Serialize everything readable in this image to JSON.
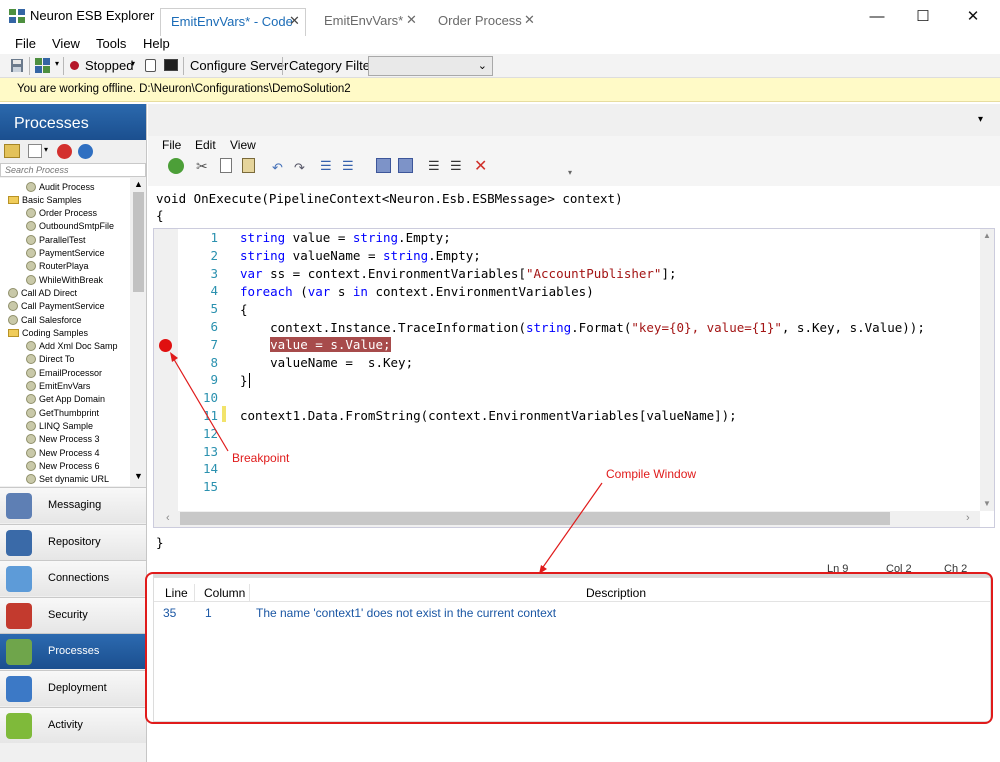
{
  "window": {
    "title": "Neuron ESB Explorer",
    "min_label": "—",
    "max_label": "☐",
    "close_label": "✕"
  },
  "menu": [
    "File",
    "View",
    "Tools",
    "Help"
  ],
  "toolbar": {
    "status": "Stopped",
    "configure_server": "Configure Server",
    "category_filter": "Category Filter",
    "category_value": ""
  },
  "offline_banner": "You are working offline. D:\\Neuron\\Configurations\\DemoSolution2",
  "left": {
    "header": "Processes",
    "search_placeholder": "Search Process",
    "tree": [
      {
        "label": "Audit Process",
        "level": 1,
        "type": "item"
      },
      {
        "label": "Basic Samples",
        "level": 0,
        "type": "folder"
      },
      {
        "label": "Order Process",
        "level": 1,
        "type": "item"
      },
      {
        "label": "OutboundSmtpFile",
        "level": 1,
        "type": "item"
      },
      {
        "label": "ParallelTest",
        "level": 1,
        "type": "item"
      },
      {
        "label": "PaymentService",
        "level": 1,
        "type": "item"
      },
      {
        "label": "RouterPlaya",
        "level": 1,
        "type": "item"
      },
      {
        "label": "WhileWithBreak",
        "level": 1,
        "type": "item"
      },
      {
        "label": "Call AD Direct",
        "level": 0,
        "type": "item"
      },
      {
        "label": "Call PaymentService",
        "level": 0,
        "type": "item"
      },
      {
        "label": "Call Salesforce",
        "level": 0,
        "type": "item"
      },
      {
        "label": "Coding Samples",
        "level": 0,
        "type": "folder"
      },
      {
        "label": "Add Xml Doc Samp",
        "level": 1,
        "type": "item"
      },
      {
        "label": "Direct To",
        "level": 1,
        "type": "item"
      },
      {
        "label": "EmailProcessor",
        "level": 1,
        "type": "item"
      },
      {
        "label": "EmitEnvVars",
        "level": 1,
        "type": "item"
      },
      {
        "label": "Get App Domain",
        "level": 1,
        "type": "item"
      },
      {
        "label": "GetThumbprint",
        "level": 1,
        "type": "item"
      },
      {
        "label": "LINQ Sample",
        "level": 1,
        "type": "item"
      },
      {
        "label": "New Process 3",
        "level": 1,
        "type": "item"
      },
      {
        "label": "New Process 4",
        "level": 1,
        "type": "item"
      },
      {
        "label": "New Process 6",
        "level": 1,
        "type": "item"
      },
      {
        "label": "Set dynamic URL",
        "level": 1,
        "type": "item"
      }
    ],
    "nav": [
      {
        "label": "Messaging",
        "icon": "messaging-icon",
        "color": "#5e7fb4",
        "active": false
      },
      {
        "label": "Repository",
        "icon": "repository-icon",
        "color": "#3a6aa8",
        "active": false
      },
      {
        "label": "Connections",
        "icon": "connections-icon",
        "color": "#5d9bd8",
        "active": false
      },
      {
        "label": "Security",
        "icon": "security-icon",
        "color": "#c33a2e",
        "active": false
      },
      {
        "label": "Processes",
        "icon": "processes-icon",
        "color": "#6fa54b",
        "active": true
      },
      {
        "label": "Deployment",
        "icon": "deployment-icon",
        "color": "#3c79c6",
        "active": false
      },
      {
        "label": "Activity",
        "icon": "activity-icon",
        "color": "#7fba3a",
        "active": false
      }
    ]
  },
  "tabs": [
    {
      "label": "EmitEnvVars* - Code",
      "active": true
    },
    {
      "label": "EmitEnvVars*",
      "active": false
    },
    {
      "label": "Order Process",
      "active": false
    }
  ],
  "code_menu": [
    "File",
    "Edit",
    "View"
  ],
  "code": {
    "signature": "void OnExecute(PipelineContext<Neuron.Esb.ESBMessage> context)",
    "open_brace": "{",
    "close_brace": "}",
    "line_numbers": [
      "1",
      "2",
      "3",
      "4",
      "5",
      "6",
      "7",
      "8",
      "9",
      "10",
      "11",
      "12",
      "13",
      "14",
      "15"
    ]
  },
  "status": {
    "ln": "Ln 9",
    "col": "Col 2",
    "ch": "Ch 2"
  },
  "errors": {
    "headers": [
      "Line",
      "Column",
      "Description"
    ],
    "rows": [
      {
        "line": "35",
        "column": "1",
        "description": "The name 'context1' does not exist in the current context"
      }
    ]
  },
  "annotations": {
    "breakpoint": "Breakpoint",
    "compile_window": "Compile Window"
  },
  "colors": {
    "accent": "#1b4f8f",
    "banner": "#fffac7",
    "annotation": "#e01b1b"
  }
}
